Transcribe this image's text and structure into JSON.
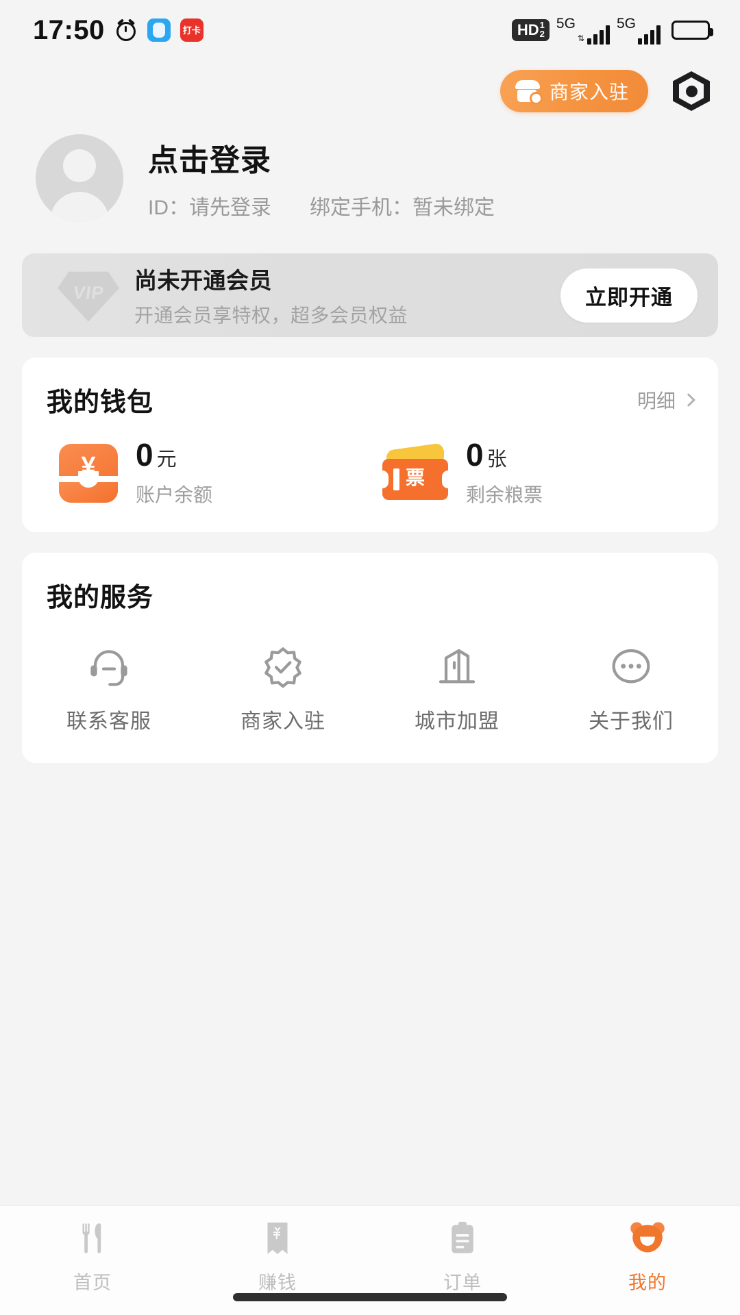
{
  "status_bar": {
    "time": "17:50",
    "alarm_icon": "alarm-clock-icon",
    "app_icon_1": "messaging-app-icon",
    "app_icon_2": "red-app-icon",
    "app_icon_2_label": "打卡",
    "hd_label": "HD",
    "hd_sup": "1",
    "hd_sub": "2",
    "sim1_network": "5G",
    "sim2_network": "5G",
    "battery_icon": "battery-full-icon"
  },
  "header": {
    "merchant_button": "商家入驻",
    "merchant_icon": "shop-icon",
    "settings_icon": "settings-hexagon-icon"
  },
  "profile": {
    "avatar_icon": "default-avatar-icon",
    "login_title": "点击登录",
    "id_text": "ID：请先登录",
    "phone_text": "绑定手机：暂未绑定"
  },
  "vip_banner": {
    "badge_text": "VIP",
    "title": "尚未开通会员",
    "subtitle": "开通会员享特权，超多会员权益",
    "button": "立即开通"
  },
  "wallet": {
    "title": "我的钱包",
    "more_label": "明细",
    "more_icon": "chevron-right-icon",
    "items": [
      {
        "icon": "yuan-wallet-icon",
        "value": "0",
        "unit": "元",
        "label": "账户余额"
      },
      {
        "icon": "ticket-icon",
        "value": "0",
        "unit": "张",
        "label": "剩余粮票"
      }
    ]
  },
  "services": {
    "title": "我的服务",
    "items": [
      {
        "icon": "headset-icon",
        "label": "联系客服"
      },
      {
        "icon": "verified-badge-icon",
        "label": "商家入驻"
      },
      {
        "icon": "building-icon",
        "label": "城市加盟"
      },
      {
        "icon": "ellipsis-circle-icon",
        "label": "关于我们"
      }
    ]
  },
  "bottom_nav": {
    "items": [
      {
        "icon": "cutlery-icon",
        "label": "首页",
        "active": false
      },
      {
        "icon": "receipt-yuan-icon",
        "label": "赚钱",
        "active": false
      },
      {
        "icon": "clipboard-icon",
        "label": "订单",
        "active": false
      },
      {
        "icon": "bear-face-icon",
        "label": "我的",
        "active": true
      }
    ]
  },
  "colors": {
    "accent_orange": "#f0762b",
    "pill_orange": "#f5933f",
    "page_bg": "#f4f4f4",
    "card_bg": "#ffffff",
    "muted_text": "#9a9a9a"
  }
}
